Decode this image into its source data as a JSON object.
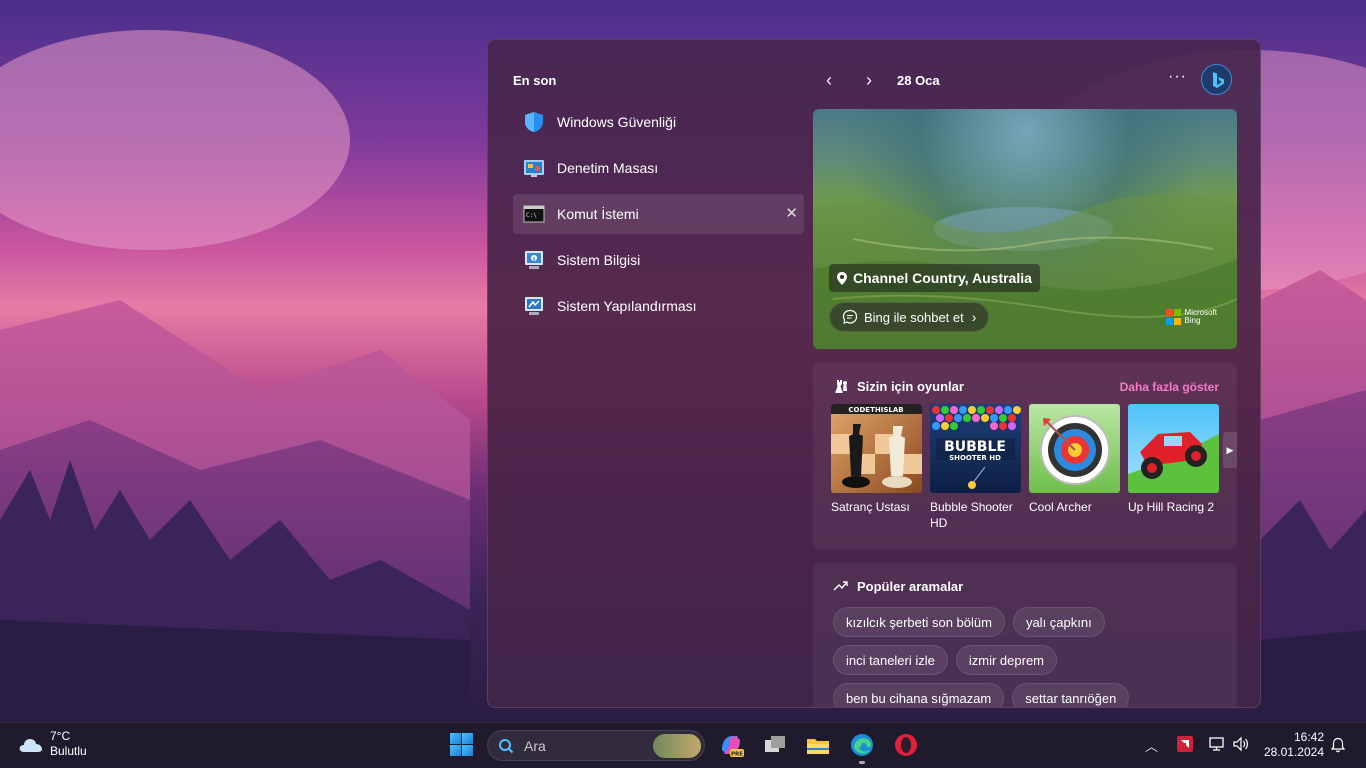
{
  "panel": {
    "recent_title": "En son",
    "recent_items": [
      {
        "label": "Windows Güvenliği",
        "icon": "shield-icon"
      },
      {
        "label": "Denetim Masası",
        "icon": "control-panel-icon"
      },
      {
        "label": "Komut İstemi",
        "icon": "terminal-icon"
      },
      {
        "label": "Sistem Bilgisi",
        "icon": "system-info-icon"
      },
      {
        "label": "Sistem Yapılandırması",
        "icon": "system-config-icon"
      }
    ],
    "close_glyph": "✕",
    "nav_prev": "‹",
    "nav_next": "›",
    "date": "28 Oca",
    "more_glyph": "···",
    "hero": {
      "location": "Channel Country, Australia",
      "chat_label": "Bing ile sohbet et",
      "chat_chevron": "›",
      "brand_line1": "Microsoft",
      "brand_line2": "Bing"
    },
    "games": {
      "title": "Sizin için oyunlar",
      "more": "Daha fazla göster",
      "arrow": "▶",
      "items": [
        {
          "name": "Satranç Ustası",
          "badge": "CODETHISLAB"
        },
        {
          "name": "Bubble Shooter HD",
          "badge": "BUBBLE SHOOTER HD"
        },
        {
          "name": "Cool Archer"
        },
        {
          "name": "Up Hill Racing 2"
        }
      ]
    },
    "popular": {
      "title": "Popüler aramalar",
      "chips": [
        [
          "kızılcık şerbeti son bölüm",
          "yalı çapkını"
        ],
        [
          "inci taneleri izle",
          "izmir deprem"
        ],
        [
          "ben bu cihana sığmazam",
          "settar tanrıöğen"
        ]
      ]
    }
  },
  "taskbar": {
    "temperature": "7°C",
    "condition": "Bulutlu",
    "search_placeholder": "Ara",
    "tray_chevron": "︿",
    "time": "16:42",
    "date": "28.01.2024"
  },
  "colors": {
    "accent": "#f27bc2",
    "start_blue": "#1a7fd6"
  }
}
